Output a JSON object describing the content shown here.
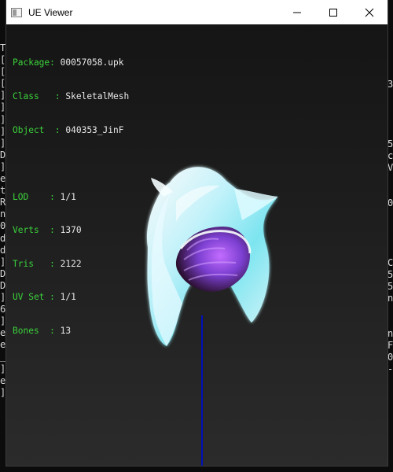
{
  "window": {
    "title": "UE Viewer"
  },
  "info": {
    "package_label": "Package:",
    "package_value": "00057058.upk",
    "class_label": "Class",
    "class_value": "SkeletalMesh",
    "object_label": "Object",
    "object_value": "040353_JinF",
    "lod_label": "LOD",
    "lod_value": "1/1",
    "verts_label": "Verts",
    "verts_value": "1370",
    "tris_label": "Tris",
    "tris_value": "2122",
    "uvset_label": "UV Set",
    "uvset_value": "1/1",
    "bones_label": "Bones",
    "bones_value": "13"
  },
  "background_console": {
    "left_chars": [
      "T",
      "[",
      "[",
      "[",
      "]",
      "]",
      "]",
      "]",
      "]",
      "D",
      "]",
      "e",
      "t",
      "R",
      "n",
      "0",
      "d",
      "d",
      "]",
      "D",
      "D",
      "]",
      "6",
      "]",
      "e",
      "e",
      "_",
      "]",
      "e",
      "]"
    ],
    "right_chars": [
      "",
      "",
      "3",
      "",
      "",
      "",
      "",
      "5",
      "c",
      "V",
      "",
      "",
      "0",
      "",
      "",
      "",
      "",
      "C",
      "5",
      "5",
      "n",
      "",
      "",
      "n",
      "F",
      "0",
      "-"
    ]
  },
  "colors": {
    "info_label": "#3bd13b",
    "info_value": "#e9e9e9",
    "axis_line": "#0010b8",
    "mesh_white": "#eafcff",
    "mesh_cyan": "#7fe9f5",
    "mesh_purple": "#7b3fd0"
  }
}
